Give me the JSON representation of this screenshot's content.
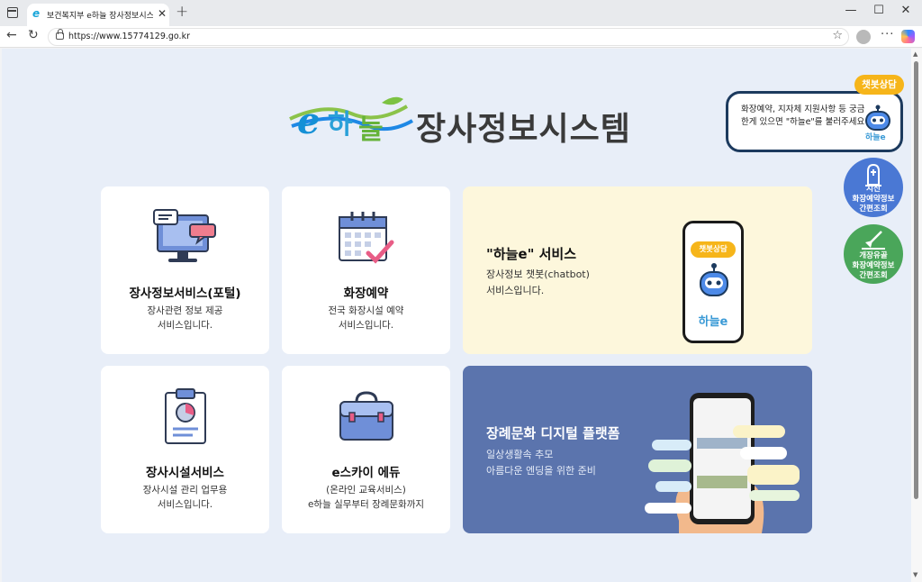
{
  "browser": {
    "tab_title": "보건복지부 e하늘 장사정보시스템",
    "tab_favicon": "e",
    "url": "https://www.15774129.go.kr",
    "new_tab": "+",
    "window_controls": [
      "—",
      "☐",
      "✕"
    ]
  },
  "site": {
    "logo_word": "e하늘",
    "logo_title": "장사정보시스템"
  },
  "cards": [
    {
      "title": "장사정보서비스(포털)",
      "desc": "장사관련 정보 제공\n서비스입니다.",
      "icon": "monitor-chat-icon"
    },
    {
      "title": "화장예약",
      "desc": "전국 화장시설 예약\n서비스입니다.",
      "icon": "calendar-check-icon"
    },
    {
      "title": "\"하늘e\" 서비스",
      "desc": "장사정보 챗봇(chatbot)\n서비스입니다.",
      "phone_badge": "챗봇상담",
      "phone_brand": "하늘e",
      "icon": "chatbot-phone-icon"
    },
    {
      "title": "장사시설서비스",
      "desc": "장사시설 관리 업무용\n서비스입니다.",
      "icon": "clipboard-chart-icon"
    },
    {
      "title": "e스카이 에듀",
      "desc": "(온라인 교육서비스)\ne하늘 실무부터 장례문화까지",
      "icon": "briefcase-icon"
    },
    {
      "title": "장례문화 디지털 플랫폼",
      "desc": "일상생활속 추모\n아름다운 엔딩을 위한 준비",
      "icon": "digital-platform-phone-icon"
    }
  ],
  "chatbot": {
    "badge": "챗봇상담",
    "text": "화장예약, 지자체 지원사항 등 궁금한게 있으면 \"하늘e\"를 불러주세요",
    "brand": "하늘e"
  },
  "quick_links": [
    {
      "label": "시신\n화장예약정보\n간편조회",
      "icon": "tombstone-icon",
      "color": "#4a78d4"
    },
    {
      "label": "개장유골\n화장예약정보\n간편조회",
      "icon": "shovel-icon",
      "color": "#4aa65a"
    }
  ],
  "colors": {
    "page_bg": "#e8eef8",
    "chatbot_card": "#fdf7dc",
    "platform_card": "#5b74ad",
    "badge": "#f6b51a"
  }
}
